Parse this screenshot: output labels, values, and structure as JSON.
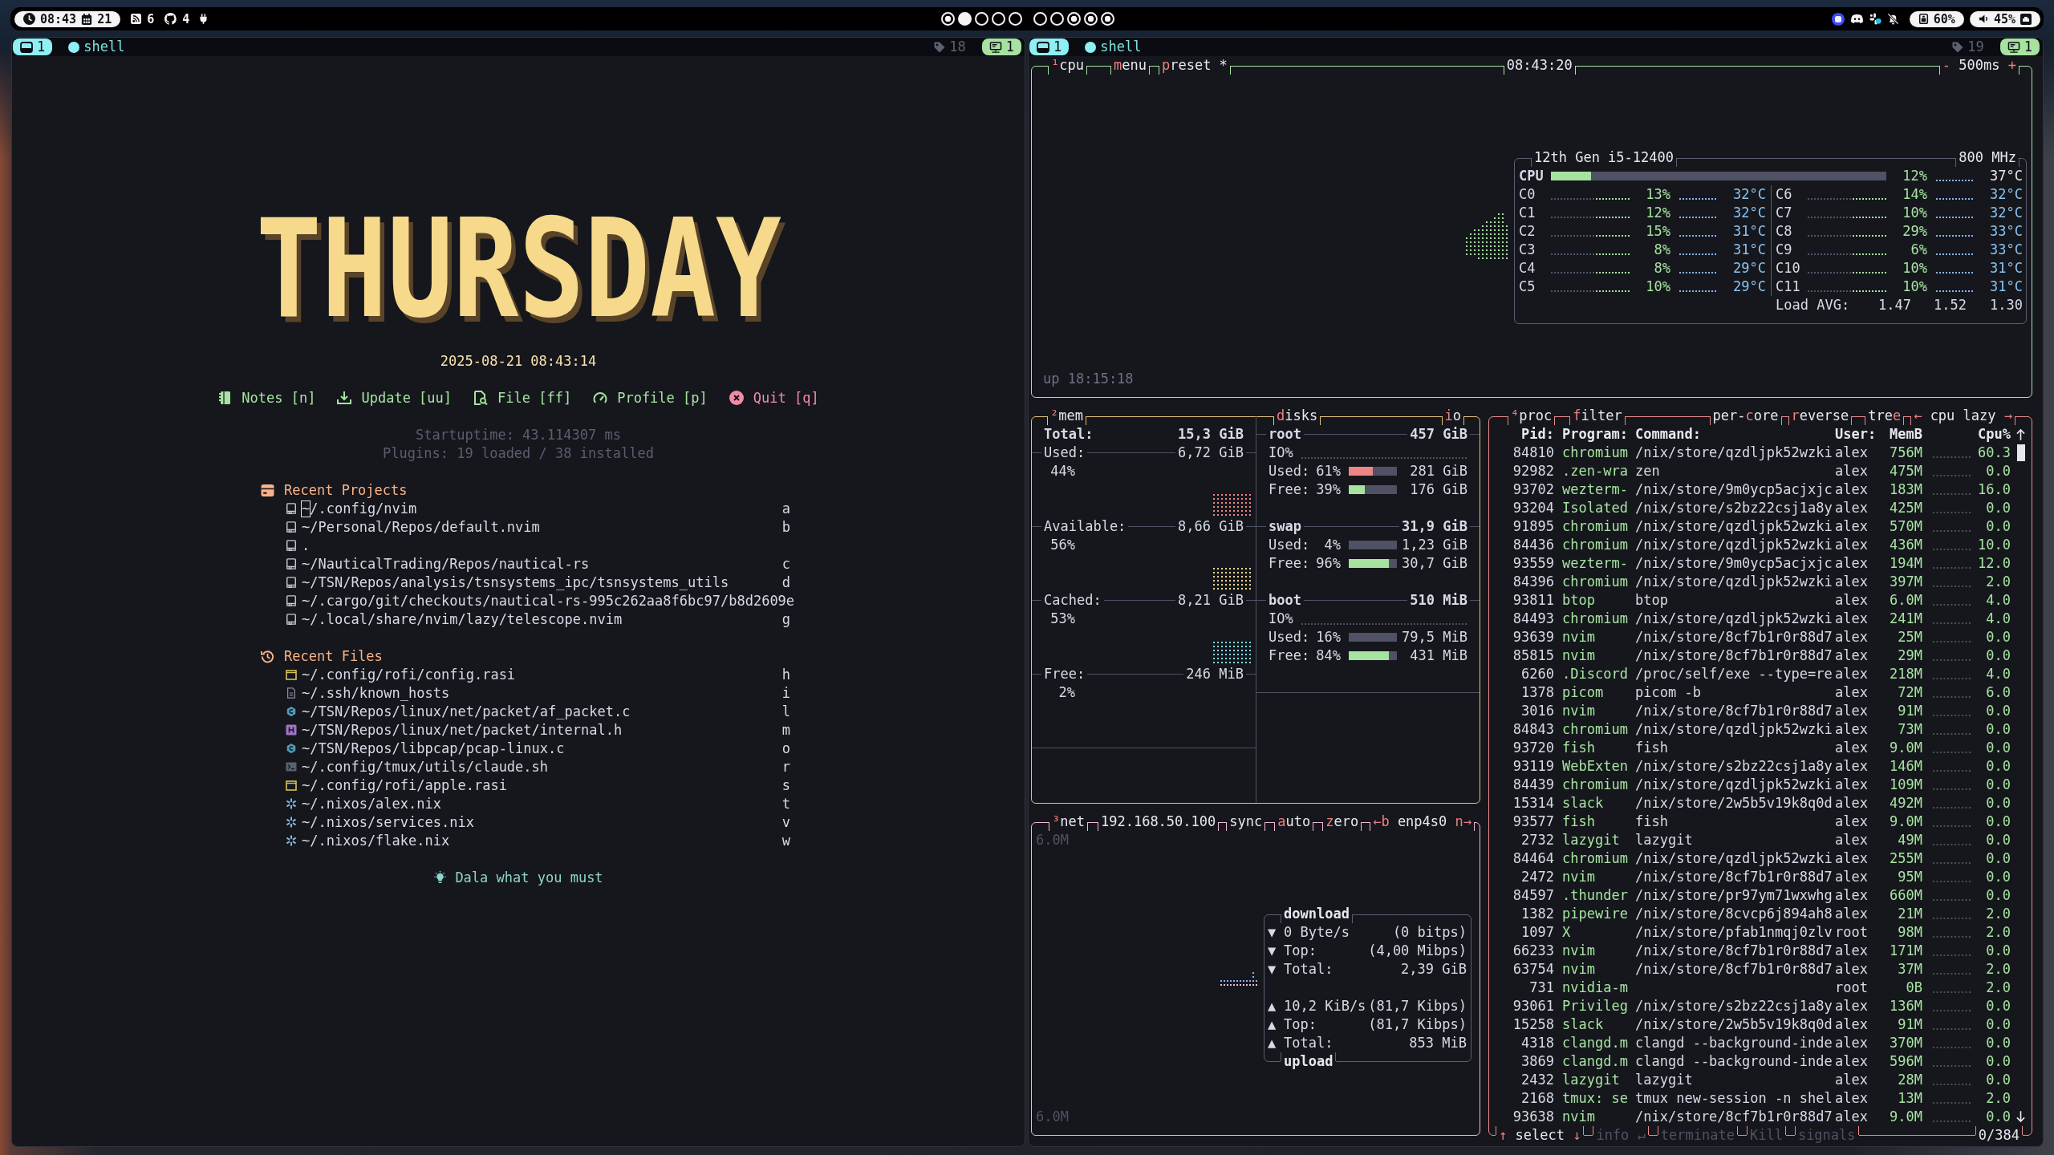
{
  "top_bar": {
    "clock": "08:43",
    "date": "21",
    "indicators": [
      {
        "kind": "feed",
        "count": "6"
      },
      {
        "kind": "github",
        "count": "4"
      }
    ],
    "workspace_groups": [
      {
        "workspaces": [
          {
            "active": false,
            "occupied": true
          },
          {
            "active": true,
            "occupied": true
          },
          {
            "active": false,
            "occupied": false
          },
          {
            "active": false,
            "occupied": false
          },
          {
            "active": false,
            "occupied": false
          }
        ]
      },
      {
        "workspaces": [
          {
            "active": false,
            "occupied": false
          },
          {
            "active": false,
            "occupied": false
          },
          {
            "active": false,
            "occupied": true
          },
          {
            "active": false,
            "occupied": true
          },
          {
            "active": false,
            "occupied": true
          }
        ]
      }
    ],
    "battery": "60%",
    "volume": "45%"
  },
  "left_pane": {
    "tab_bar": {
      "window_number": "1",
      "tab_title": "shell",
      "tag_count": "18",
      "badge_number": "1"
    },
    "dashboard": {
      "title": "THURSDAY",
      "datetime": "2025-08-21 08:43:14",
      "actions": [
        {
          "kind": "notes",
          "label": "Notes [n]"
        },
        {
          "kind": "update",
          "label": "Update [uu]"
        },
        {
          "kind": "file",
          "label": "File [ff]"
        },
        {
          "kind": "profile",
          "label": "Profile [p]"
        },
        {
          "kind": "quit",
          "label": "Quit [q]"
        }
      ],
      "startup": "Startuptime: 43.114307 ms",
      "plugins": "Plugins: 19 loaded / 38 installed",
      "recent_projects": {
        "title": "Recent Projects",
        "items": [
          {
            "path": "~/.config/nvim",
            "key": "a",
            "cursor": true
          },
          {
            "path": "~/Personal/Repos/default.nvim",
            "key": "b",
            "cursor": false
          },
          {
            "path": ".",
            "cursor": false
          },
          {
            "path": "~/NauticalTrading/Repos/nautical-rs",
            "key": "c",
            "cursor": false
          },
          {
            "path": "~/TSN/Repos/analysis/tsnsystems_ipc/tsnsystems_utils",
            "key": "d",
            "cursor": false
          },
          {
            "path": "~/.cargo/git/checkouts/nautical-rs-995c262aa8f6bc97/b8d2609",
            "key": "e",
            "cursor": false
          },
          {
            "path": "~/.local/share/nvim/lazy/telescope.nvim",
            "key": "g",
            "cursor": false
          }
        ]
      },
      "recent_files": {
        "title": "Recent Files",
        "items": [
          {
            "kind": "rasi",
            "path": "~/.config/rofi/config.rasi",
            "key": "h"
          },
          {
            "kind": "text",
            "path": "~/.ssh/known_hosts",
            "key": "i"
          },
          {
            "kind": "c",
            "path": "~/TSN/Repos/linux/net/packet/af_packet.c",
            "key": "l"
          },
          {
            "kind": "h",
            "path": "~/TSN/Repos/linux/net/packet/internal.h",
            "key": "m"
          },
          {
            "kind": "c",
            "path": "~/TSN/Repos/libpcap/pcap-linux.c",
            "key": "o"
          },
          {
            "kind": "shell",
            "path": "~/.config/tmux/utils/claude.sh",
            "key": "r"
          },
          {
            "kind": "rasi",
            "path": "~/.config/rofi/apple.rasi",
            "key": "s"
          },
          {
            "kind": "nix",
            "path": "~/.nixos/alex.nix",
            "key": "t"
          },
          {
            "kind": "nix",
            "path": "~/.nixos/services.nix",
            "key": "v"
          },
          {
            "kind": "nix",
            "path": "~/.nixos/flake.nix",
            "key": "w"
          }
        ]
      },
      "footer": "Dala what you must"
    }
  },
  "right_pane": {
    "tab_bar": {
      "window_number": "1",
      "tab_title": "shell",
      "tag_count": "19",
      "badge_number": "1"
    },
    "btop": {
      "cpu": {
        "label": [
          {
            "kind": "hotkey",
            "text": "¹"
          },
          {
            "kind": "plain",
            "text": "cpu"
          }
        ],
        "menu": [
          {
            "kind": "hotkey",
            "text": "m"
          },
          {
            "kind": "plain",
            "text": "enu"
          }
        ],
        "preset": [
          {
            "kind": "hotkey",
            "text": "p"
          },
          {
            "kind": "plain",
            "text": "reset *"
          }
        ],
        "clock": "08:43:20",
        "interval": [
          {
            "kind": "hotkey",
            "text": "-"
          },
          {
            "kind": "plain",
            "text": " 500ms "
          },
          {
            "kind": "hotkey",
            "text": "+"
          }
        ],
        "uptime": "up 18:15:18",
        "model": "12th Gen i5-12400",
        "frequency": "800 MHz",
        "total": {
          "label": "CPU",
          "level": 0.12,
          "usage": "12%",
          "temp": "37°C"
        },
        "cores": [
          {
            "name": "C0",
            "usage": "13%",
            "temp": "32°C"
          },
          {
            "name": "C1",
            "usage": "12%",
            "temp": "32°C"
          },
          {
            "name": "C2",
            "usage": "15%",
            "temp": "31°C"
          },
          {
            "name": "C3",
            "usage": "8%",
            "temp": "31°C"
          },
          {
            "name": "C4",
            "usage": "8%",
            "temp": "29°C"
          },
          {
            "name": "C5",
            "usage": "10%",
            "temp": "29°C"
          },
          {
            "name": "C6",
            "usage": "14%",
            "temp": "32°C"
          },
          {
            "name": "C7",
            "usage": "10%",
            "temp": "32°C"
          },
          {
            "name": "C8",
            "usage": "29%",
            "temp": "33°C"
          },
          {
            "name": "C9",
            "usage": "6%",
            "temp": "33°C"
          },
          {
            "name": "C10",
            "usage": "10%",
            "temp": "31°C"
          },
          {
            "name": "C11",
            "usage": "10%",
            "temp": "31°C"
          }
        ],
        "load_label": "Load AVG:",
        "load": [
          "1.47",
          "1.52",
          "1.30"
        ]
      },
      "mem": {
        "label": [
          {
            "kind": "hotkey",
            "text": "²"
          },
          {
            "kind": "plain",
            "text": "mem"
          }
        ],
        "total": {
          "label": "Total:",
          "value": "15,3 GiB"
        },
        "items": [
          {
            "label": "Used:",
            "value": "6,72 GiB",
            "percent": "44%",
            "color": "#ee8585"
          },
          {
            "label": "Available:",
            "value": "8,66 GiB",
            "percent": "56%",
            "color": "#f0d58c"
          },
          {
            "label": "Cached:",
            "value": "8,21 GiB",
            "percent": "53%",
            "color": "#7fd8e0"
          },
          {
            "label": "Free:",
            "value": "246 MiB",
            "percent": "2%"
          }
        ]
      },
      "disks": {
        "label": [
          {
            "kind": "hotkey",
            "text": "d"
          },
          {
            "kind": "plain",
            "text": "isks"
          }
        ],
        "io_toggle": [
          {
            "kind": "hotkey",
            "text": "i"
          },
          {
            "kind": "plain",
            "text": "o"
          }
        ],
        "items": [
          {
            "name": "root",
            "size": "457 GiB",
            "io_label": "IO%",
            "meters": [
              {
                "kind": "used",
                "label": "Used:",
                "percent": "61%",
                "level": 0.5,
                "value": "281 GiB"
              },
              {
                "kind": "free",
                "label": "Free:",
                "percent": "39%",
                "level": 0.34,
                "value": "176 GiB"
              }
            ]
          },
          {
            "name": "swap",
            "size": "31,9 GiB",
            "meters": [
              {
                "label": "Used:",
                "percent": "4%",
                "value": "1,23 GiB"
              },
              {
                "kind": "free",
                "label": "Free:",
                "percent": "96%",
                "level": 0.83,
                "value": "30,7 GiB"
              }
            ]
          },
          {
            "name": "boot",
            "size": "510 MiB",
            "io_label": "IO%",
            "meters": [
              {
                "label": "Used:",
                "percent": "16%",
                "value": "79,5 MiB"
              },
              {
                "kind": "free",
                "label": "Free:",
                "percent": "84%",
                "level": 0.83,
                "value": "431 MiB"
              }
            ]
          }
        ]
      },
      "net": {
        "label": [
          {
            "kind": "hotkey",
            "text": "³"
          },
          {
            "kind": "plain",
            "text": "net"
          }
        ],
        "address": "192.168.50.100",
        "sync": "sync",
        "auto": [
          {
            "kind": "hotkey",
            "text": "a"
          },
          {
            "kind": "plain",
            "text": "uto"
          }
        ],
        "zero": [
          {
            "kind": "hotkey",
            "text": "z"
          },
          {
            "kind": "plain",
            "text": "ero"
          }
        ],
        "interface": [
          {
            "kind": "hotkey",
            "text": "←b"
          },
          {
            "kind": "plain",
            "text": " enp4s0 "
          },
          {
            "kind": "hotkey",
            "text": "n→"
          }
        ],
        "scale_top": "6.0M",
        "scale_bottom": "6.0M",
        "download": {
          "title": "download",
          "rows": [
            {
              "arrow": "▼",
              "label": "0 Byte/s",
              "value": "(0 bitps)"
            },
            {
              "arrow": "▼",
              "label": "Top:",
              "value": "(4,00 Mibps)"
            },
            {
              "arrow": "▼",
              "label": "Total:",
              "value": "2,39 GiB"
            }
          ]
        },
        "upload": {
          "title": "upload",
          "rows": [
            {
              "arrow": "▲",
              "label": "10,2 KiB/s",
              "value": "(81,7 Kibps)"
            },
            {
              "arrow": "▲",
              "label": "Top:",
              "value": "(81,7 Kibps)"
            },
            {
              "arrow": "▲",
              "label": "Total:",
              "value": "853 MiB"
            }
          ]
        }
      },
      "proc": {
        "label": [
          {
            "kind": "hotkey",
            "text": "⁴"
          },
          {
            "kind": "plain",
            "text": "proc"
          }
        ],
        "filter": [
          {
            "kind": "hotkey",
            "text": "f"
          },
          {
            "kind": "plain",
            "text": "ilter"
          }
        ],
        "per_core": [
          {
            "kind": "plain",
            "text": "per-"
          },
          {
            "kind": "hotkey",
            "text": "c"
          },
          {
            "kind": "plain",
            "text": "ore"
          }
        ],
        "reverse": [
          {
            "kind": "hotkey",
            "text": "r"
          },
          {
            "kind": "plain",
            "text": "everse"
          }
        ],
        "tree": [
          {
            "kind": "plain",
            "text": "tre"
          },
          {
            "kind": "hotkey",
            "text": "e"
          }
        ],
        "sort": [
          {
            "kind": "hotkey",
            "text": "←"
          },
          {
            "kind": "plain",
            "text": " cpu lazy "
          },
          {
            "kind": "hotkey",
            "text": "→"
          }
        ],
        "columns": {
          "pid": "Pid:",
          "program": "Program:",
          "command": "Command:",
          "user": "User:",
          "mem": "MemB",
          "cpu": "Cpu%"
        },
        "rows": [
          {
            "pid": "84810",
            "program": "chromium",
            "command": "/nix/store/qzdljpk52wzki",
            "user": "alex",
            "mem": "756M",
            "cpu": "60.3"
          },
          {
            "pid": "92982",
            "program": ".zen-wra",
            "command": "zen",
            "user": "alex",
            "mem": "475M",
            "cpu": "0.0"
          },
          {
            "pid": "93702",
            "program": "wezterm-",
            "command": "/nix/store/9m0ycp5acjxjc",
            "user": "alex",
            "mem": "183M",
            "cpu": "16.0"
          },
          {
            "pid": "93204",
            "program": "Isolated",
            "command": "/nix/store/s2bz22csj1a8y",
            "user": "alex",
            "mem": "425M",
            "cpu": "0.0"
          },
          {
            "pid": "91895",
            "program": "chromium",
            "command": "/nix/store/qzdljpk52wzki",
            "user": "alex",
            "mem": "570M",
            "cpu": "0.0"
          },
          {
            "pid": "84436",
            "program": "chromium",
            "command": "/nix/store/qzdljpk52wzki",
            "user": "alex",
            "mem": "436M",
            "cpu": "10.0"
          },
          {
            "pid": "93559",
            "program": "wezterm-",
            "command": "/nix/store/9m0ycp5acjxjc",
            "user": "alex",
            "mem": "194M",
            "cpu": "12.0"
          },
          {
            "pid": "84396",
            "program": "chromium",
            "command": "/nix/store/qzdljpk52wzki",
            "user": "alex",
            "mem": "397M",
            "cpu": "2.0"
          },
          {
            "pid": "93811",
            "program": "btop",
            "command": "btop",
            "user": "alex",
            "mem": "6.0M",
            "cpu": "4.0"
          },
          {
            "pid": "84493",
            "program": "chromium",
            "command": "/nix/store/qzdljpk52wzki",
            "user": "alex",
            "mem": "241M",
            "cpu": "4.0"
          },
          {
            "pid": "93639",
            "program": "nvim",
            "command": "/nix/store/8cf7b1r0r88d7",
            "user": "alex",
            "mem": "25M",
            "cpu": "0.0"
          },
          {
            "pid": "85815",
            "program": "nvim",
            "command": "/nix/store/8cf7b1r0r88d7",
            "user": "alex",
            "mem": "29M",
            "cpu": "0.0"
          },
          {
            "pid": "6260",
            "program": ".Discord",
            "command": "/proc/self/exe --type=re",
            "user": "alex",
            "mem": "218M",
            "cpu": "4.0"
          },
          {
            "pid": "1378",
            "program": "picom",
            "command": "picom -b",
            "user": "alex",
            "mem": "72M",
            "cpu": "6.0"
          },
          {
            "pid": "3016",
            "program": "nvim",
            "command": "/nix/store/8cf7b1r0r88d7",
            "user": "alex",
            "mem": "91M",
            "cpu": "0.0"
          },
          {
            "pid": "84843",
            "program": "chromium",
            "command": "/nix/store/qzdljpk52wzki",
            "user": "alex",
            "mem": "73M",
            "cpu": "0.0"
          },
          {
            "pid": "93720",
            "program": "fish",
            "command": "fish",
            "user": "alex",
            "mem": "9.0M",
            "cpu": "0.0"
          },
          {
            "pid": "93119",
            "program": "WebExten",
            "command": "/nix/store/s2bz22csj1a8y",
            "user": "alex",
            "mem": "146M",
            "cpu": "0.0"
          },
          {
            "pid": "84439",
            "program": "chromium",
            "command": "/nix/store/qzdljpk52wzki",
            "user": "alex",
            "mem": "109M",
            "cpu": "0.0"
          },
          {
            "pid": "15314",
            "program": "slack",
            "command": "/nix/store/2w5b5v19k8q0d",
            "user": "alex",
            "mem": "492M",
            "cpu": "0.0"
          },
          {
            "pid": "93577",
            "program": "fish",
            "command": "fish",
            "user": "alex",
            "mem": "9.0M",
            "cpu": "0.0"
          },
          {
            "pid": "2732",
            "program": "lazygit",
            "command": "lazygit",
            "user": "alex",
            "mem": "49M",
            "cpu": "0.0"
          },
          {
            "pid": "84464",
            "program": "chromium",
            "command": "/nix/store/qzdljpk52wzki",
            "user": "alex",
            "mem": "255M",
            "cpu": "0.0"
          },
          {
            "pid": "2472",
            "program": "nvim",
            "command": "/nix/store/8cf7b1r0r88d7",
            "user": "alex",
            "mem": "95M",
            "cpu": "0.0"
          },
          {
            "pid": "84597",
            "program": ".thunder",
            "command": "/nix/store/pr97ym71wxwhg",
            "user": "alex",
            "mem": "660M",
            "cpu": "0.0"
          },
          {
            "pid": "1382",
            "program": "pipewire",
            "command": "/nix/store/8cvcp6j894ah8",
            "user": "alex",
            "mem": "21M",
            "cpu": "2.0"
          },
          {
            "pid": "1097",
            "program": "X",
            "command": "/nix/store/pfab1nmqj0zlv",
            "user": "root",
            "mem": "98M",
            "cpu": "2.0"
          },
          {
            "pid": "66233",
            "program": "nvim",
            "command": "/nix/store/8cf7b1r0r88d7",
            "user": "alex",
            "mem": "171M",
            "cpu": "0.0"
          },
          {
            "pid": "63754",
            "program": "nvim",
            "command": "/nix/store/8cf7b1r0r88d7",
            "user": "alex",
            "mem": "37M",
            "cpu": "2.0"
          },
          {
            "pid": "731",
            "program": "nvidia-m",
            "user": "root",
            "mem": "0B",
            "cpu": "2.0"
          },
          {
            "pid": "93061",
            "program": "Privileg",
            "command": "/nix/store/s2bz22csj1a8y",
            "user": "alex",
            "mem": "136M",
            "cpu": "0.0"
          },
          {
            "pid": "15258",
            "program": "slack",
            "command": "/nix/store/2w5b5v19k8q0d",
            "user": "alex",
            "mem": "91M",
            "cpu": "0.0"
          },
          {
            "pid": "4318",
            "program": "clangd.m",
            "command": "clangd --background-inde",
            "user": "alex",
            "mem": "370M",
            "cpu": "0.0"
          },
          {
            "pid": "3869",
            "program": "clangd.m",
            "command": "clangd --background-inde",
            "user": "alex",
            "mem": "596M",
            "cpu": "0.0"
          },
          {
            "pid": "2432",
            "program": "lazygit",
            "command": "lazygit",
            "user": "alex",
            "mem": "28M",
            "cpu": "0.0"
          },
          {
            "pid": "2168",
            "program": "tmux: se",
            "command": "tmux new-session -n shel",
            "user": "alex",
            "mem": "13M",
            "cpu": "2.0"
          },
          {
            "pid": "93638",
            "program": "nvim",
            "command": "/nix/store/8cf7b1r0r88d7",
            "user": "alex",
            "mem": "9.0M",
            "cpu": "0.0"
          }
        ],
        "actions": [
          {
            "parts": [
              {
                "kind": "hotkey",
                "text": "↑"
              },
              {
                "kind": "plain",
                "text": " select "
              },
              {
                "kind": "hotkey",
                "text": "↓"
              }
            ],
            "disabled": false
          },
          {
            "parts": [
              {
                "kind": "plain",
                "text": "info ↵"
              }
            ],
            "disabled": true
          },
          {
            "parts": [
              {
                "kind": "plain",
                "text": "terminate"
              }
            ],
            "disabled": true
          },
          {
            "parts": [
              {
                "kind": "plain",
                "text": "Kill"
              }
            ],
            "disabled": true
          },
          {
            "parts": [
              {
                "kind": "plain",
                "text": "signals"
              }
            ],
            "disabled": true
          }
        ],
        "count": "0/384"
      }
    }
  }
}
